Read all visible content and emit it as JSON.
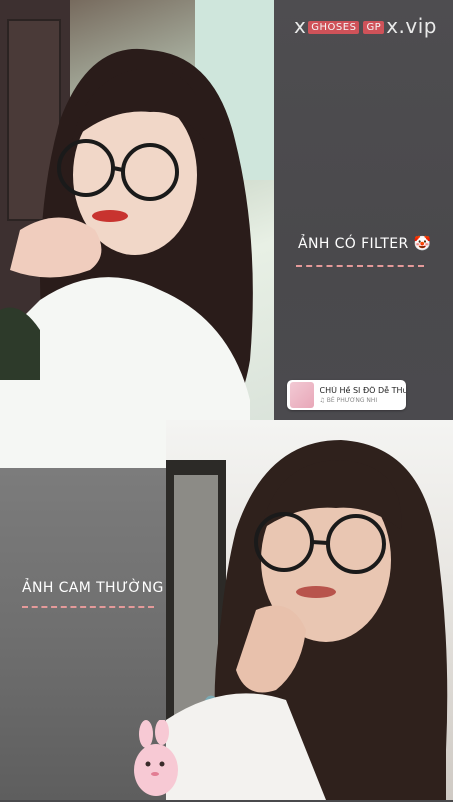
{
  "watermark": {
    "prefix": "x",
    "badge_a": "GHOSES",
    "badge_b": "GP",
    "suffix": "x.vip"
  },
  "captions": {
    "filter": "ẢNH CÓ FILTER 🤡",
    "normal": "ẢNH CAM THƯỜNG 😶‍🌫️"
  },
  "music": {
    "title": "CHÚ Hề SI ĐÔ Dễ THư...",
    "artist": "♫ BÉ PHƯƠNG NHI"
  },
  "colors": {
    "dash": "#e59a9a",
    "panel_right": "#4c4b4e",
    "panel_left": "#707070"
  }
}
